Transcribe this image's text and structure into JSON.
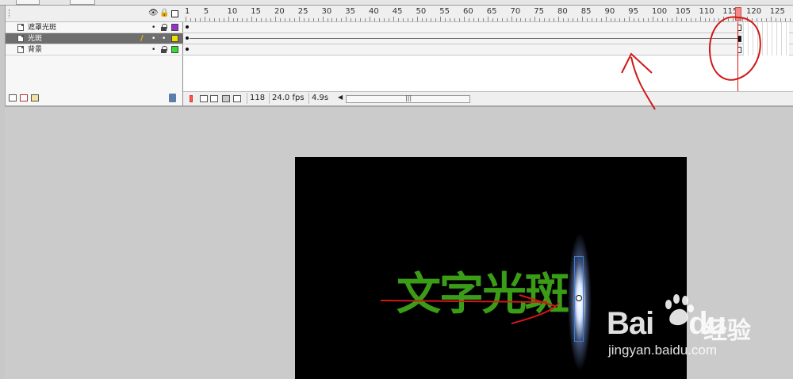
{
  "timeline": {
    "layers": [
      {
        "name": "遮罩光斑",
        "color": "#9a2fd0",
        "selected": false
      },
      {
        "name": "光斑",
        "color": "#f0e000",
        "selected": true
      },
      {
        "name": "背景",
        "color": "#33dd33",
        "selected": false
      }
    ],
    "ruler_labels": [
      "1",
      "5",
      "10",
      "15",
      "20",
      "25",
      "30",
      "35",
      "40",
      "45",
      "50",
      "55",
      "60",
      "65",
      "70",
      "75",
      "80",
      "85",
      "90",
      "95",
      "100",
      "105",
      "110",
      "115",
      "120",
      "125"
    ],
    "current_frame": "118",
    "fps": "24.0 fps",
    "elapsed": "4.9s"
  },
  "stage": {
    "text": "文字光斑",
    "text_color": "#3b9d17",
    "background_color": "#000000"
  },
  "watermark": {
    "brand": "Bai",
    "brand_suffix": "du",
    "product": "经验",
    "url": "jingyan.baidu.com"
  },
  "icons": {
    "header": [
      "eye-icon",
      "lock-icon",
      "outline-icon"
    ],
    "footer": [
      "new-layer-icon",
      "motion-guide-icon",
      "new-folder-icon",
      "trash-icon"
    ],
    "status": [
      "center-frame-icon",
      "onion-skin-icon",
      "onion-outline-icon",
      "edit-multiple-icon",
      "onion-markers-icon"
    ]
  },
  "colors": {
    "annotation": "#d01818",
    "playhead": "#e01010"
  }
}
